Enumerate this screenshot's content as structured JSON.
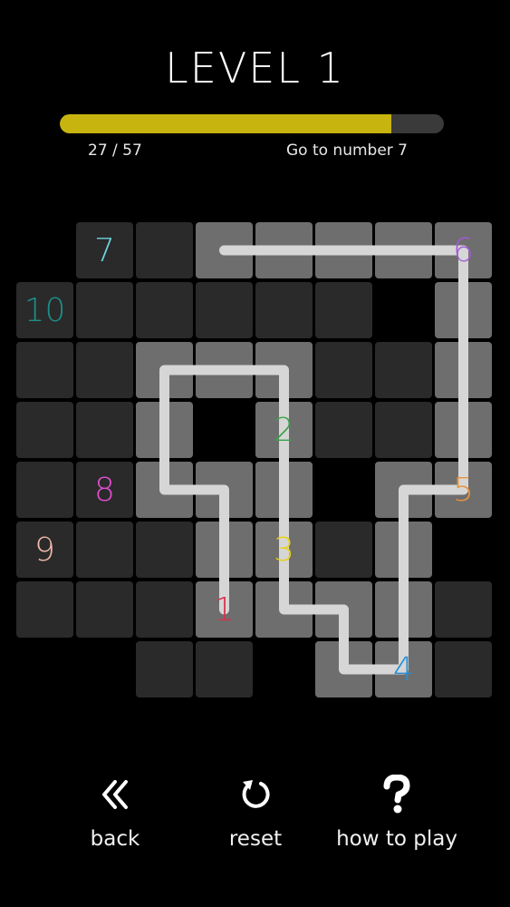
{
  "header": {
    "title": "LEVEL 1"
  },
  "progress": {
    "text": "27 / 57",
    "fraction": 0.8632,
    "fill_color": "#c8b40e",
    "track_color": "#3a3a3a"
  },
  "hint": {
    "text": "Go to number 7"
  },
  "colors": {
    "dark_cell": "#2a2a2a",
    "lit_cell": "#6e6e6e",
    "path": "#d6d6d6"
  },
  "board": {
    "dark": [
      [
        1,
        0
      ],
      [
        2,
        0
      ],
      [
        0,
        1
      ],
      [
        1,
        1
      ],
      [
        2,
        1
      ],
      [
        3,
        1
      ],
      [
        4,
        1
      ],
      [
        5,
        1
      ],
      [
        0,
        2
      ],
      [
        1,
        2
      ],
      [
        4,
        2
      ],
      [
        5,
        2
      ],
      [
        6,
        2
      ],
      [
        0,
        3
      ],
      [
        1,
        3
      ],
      [
        4,
        3
      ],
      [
        5,
        3
      ],
      [
        6,
        3
      ],
      [
        0,
        4
      ],
      [
        1,
        4
      ],
      [
        4,
        4
      ],
      [
        0,
        5
      ],
      [
        1,
        5
      ],
      [
        2,
        5
      ],
      [
        5,
        5
      ],
      [
        0,
        6
      ],
      [
        1,
        6
      ],
      [
        2,
        6
      ],
      [
        7,
        6
      ],
      [
        2,
        7
      ],
      [
        3,
        7
      ],
      [
        7,
        7
      ]
    ],
    "lit": [
      [
        3,
        0
      ],
      [
        4,
        0
      ],
      [
        5,
        0
      ],
      [
        6,
        0
      ],
      [
        7,
        0
      ],
      [
        7,
        1
      ],
      [
        2,
        2
      ],
      [
        3,
        2
      ],
      [
        4,
        2
      ],
      [
        7,
        2
      ],
      [
        2,
        3
      ],
      [
        4,
        3
      ],
      [
        7,
        3
      ],
      [
        2,
        4
      ],
      [
        3,
        4
      ],
      [
        4,
        4
      ],
      [
        6,
        4
      ],
      [
        7,
        4
      ],
      [
        3,
        5
      ],
      [
        4,
        5
      ],
      [
        6,
        5
      ],
      [
        3,
        6
      ],
      [
        4,
        6
      ],
      [
        5,
        6
      ],
      [
        6,
        6
      ],
      [
        5,
        7
      ],
      [
        6,
        7
      ]
    ],
    "numbers": [
      {
        "label": "7",
        "col": 1,
        "row": 0,
        "color": "#6ed3e0"
      },
      {
        "label": "6",
        "col": 7,
        "row": 0,
        "color": "#a35ad6"
      },
      {
        "label": "10",
        "col": 0,
        "row": 1,
        "color": "#1c8f8a"
      },
      {
        "label": "2",
        "col": 4,
        "row": 3,
        "color": "#3aa34a"
      },
      {
        "label": "8",
        "col": 1,
        "row": 4,
        "color": "#e04fd0"
      },
      {
        "label": "5",
        "col": 7,
        "row": 4,
        "color": "#e8923a"
      },
      {
        "label": "9",
        "col": 0,
        "row": 5,
        "color": "#f2b8a8"
      },
      {
        "label": "3",
        "col": 4,
        "row": 5,
        "color": "#e6d21a"
      },
      {
        "label": "1",
        "col": 3,
        "row": 6,
        "color": "#d6334a"
      },
      {
        "label": "4",
        "col": 6,
        "row": 7,
        "color": "#2a8fd6"
      }
    ],
    "path": [
      [
        3,
        6
      ],
      [
        3,
        4
      ],
      [
        2,
        4
      ],
      [
        2,
        2
      ],
      [
        4,
        2
      ],
      [
        4,
        6
      ],
      [
        5,
        6
      ],
      [
        5,
        7
      ],
      [
        6,
        7
      ],
      [
        6,
        4
      ],
      [
        7,
        4
      ],
      [
        7,
        0
      ],
      [
        3,
        0
      ]
    ]
  },
  "footer": {
    "back": {
      "label": "back",
      "icon": "double-chevron-left-icon"
    },
    "reset": {
      "label": "reset",
      "icon": "reset-icon"
    },
    "help": {
      "label": "how to play",
      "icon": "question-mark-icon"
    }
  }
}
